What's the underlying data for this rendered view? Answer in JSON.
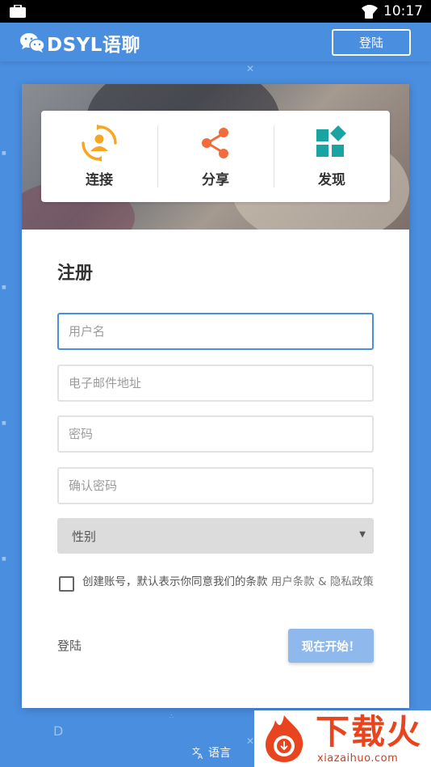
{
  "status_bar": {
    "time": "10:17"
  },
  "app_bar": {
    "brand_name": "DSYL语聊",
    "login_button": "登陆"
  },
  "features": [
    {
      "icon": "connect-icon",
      "label": "连接"
    },
    {
      "icon": "share-icon",
      "label": "分享"
    },
    {
      "icon": "discover-icon",
      "label": "发现"
    }
  ],
  "form": {
    "title": "注册",
    "username_placeholder": "用户名",
    "email_placeholder": "电子邮件地址",
    "password_placeholder": "密码",
    "confirm_placeholder": "确认密码",
    "gender_selected": "性别",
    "agree_text": "创建账号，默认表示你同意我们的条款",
    "terms_link": "用户条款",
    "amp": "&",
    "privacy_link": "隐私政策",
    "login_link": "登陆",
    "start_button": "现在开始！"
  },
  "footer": {
    "language": "语言"
  },
  "watermark": {
    "title": "下载火",
    "url": "xiazaihuo.com"
  },
  "colors": {
    "primary": "#4a8ee0",
    "start_button": "#8fb8ec",
    "connect_orange": "#f5a623",
    "share_red": "#f26b3a",
    "discover_teal": "#1aa3a3",
    "watermark_red": "#e8451f"
  }
}
